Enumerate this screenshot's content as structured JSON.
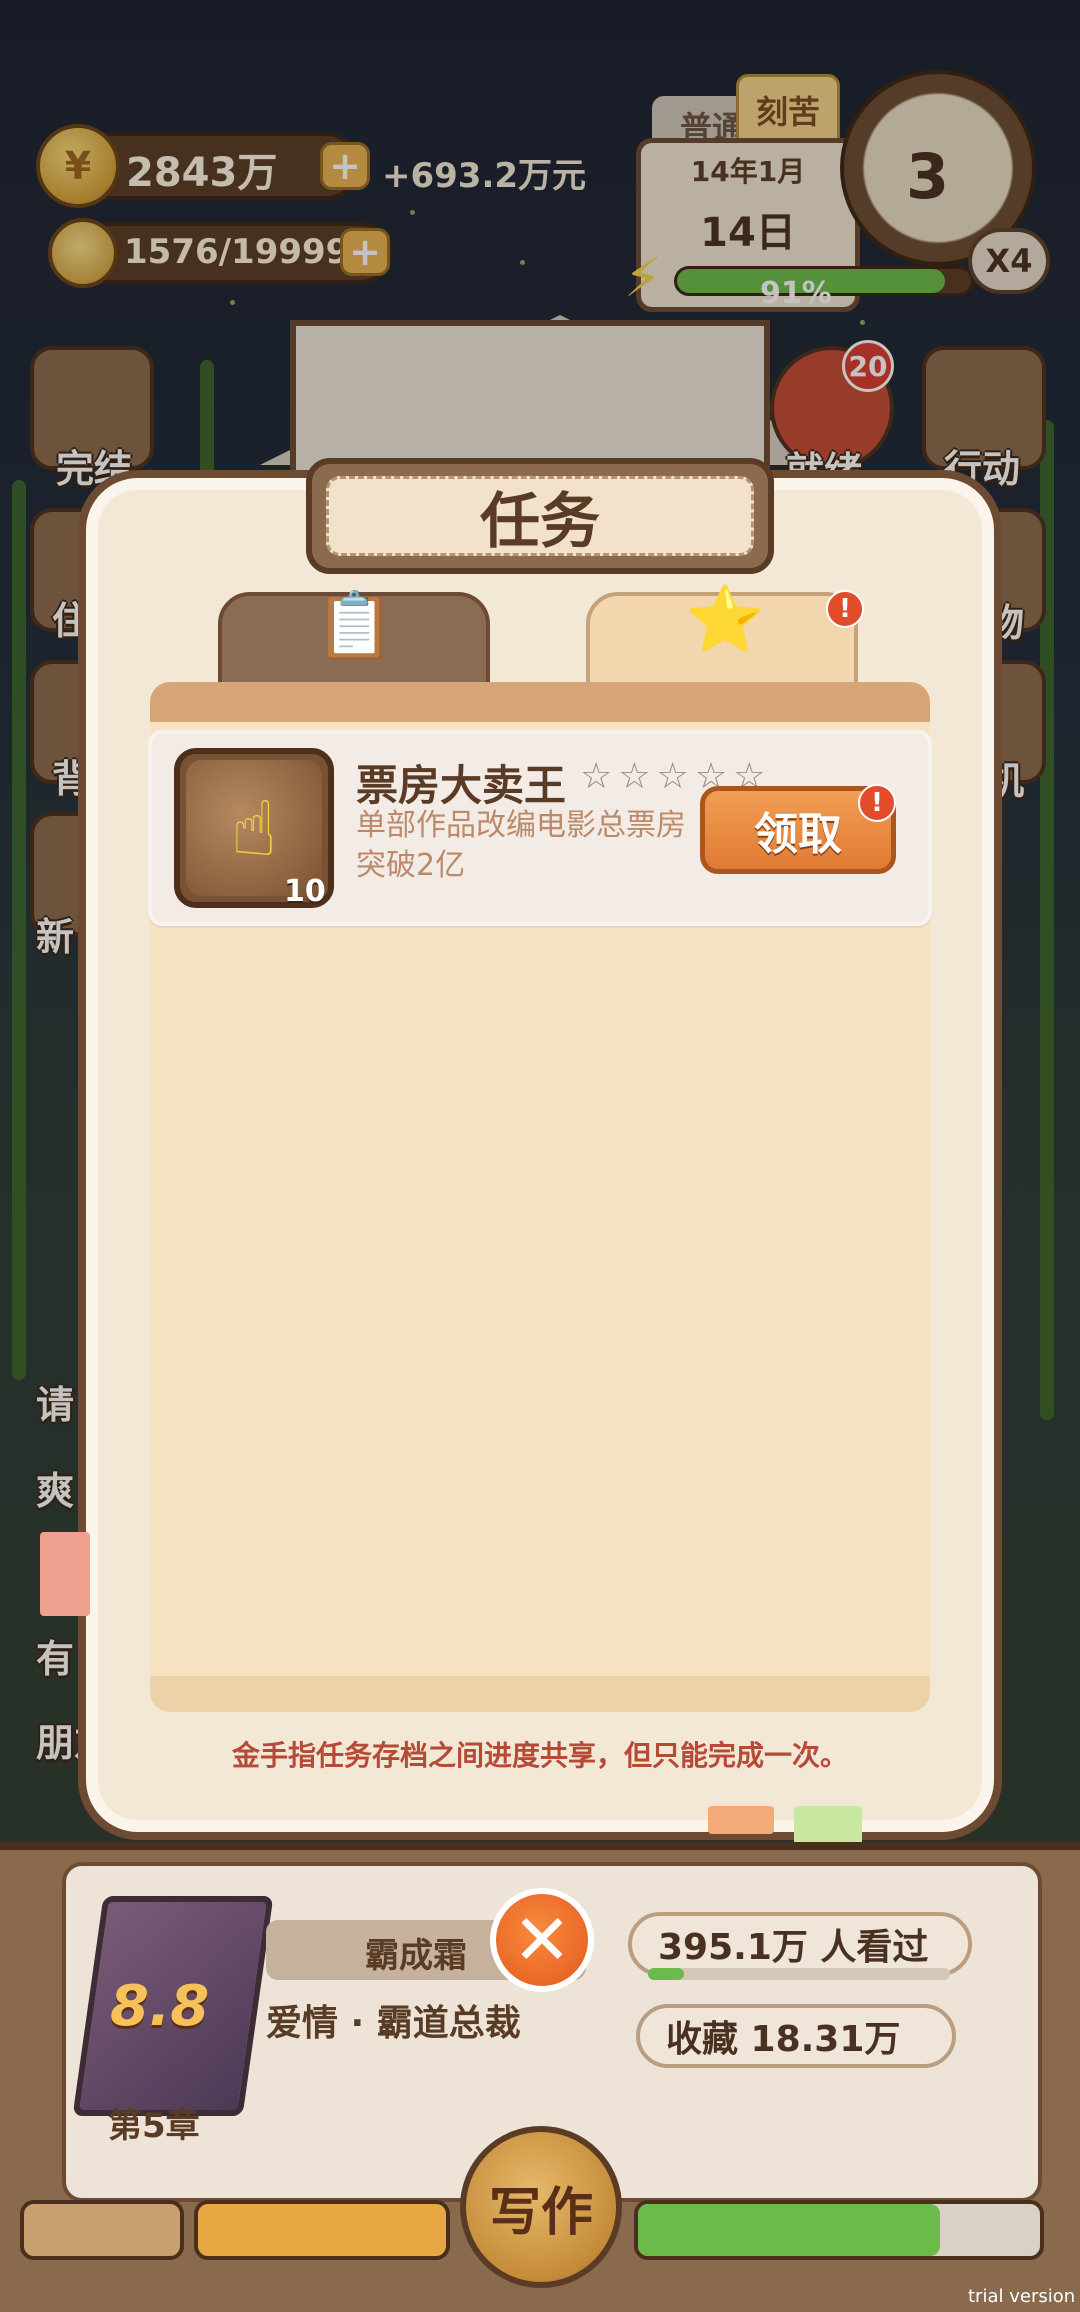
{
  "hud": {
    "money": "2843万",
    "money_rate": "+693.2万元",
    "energy": "1576/19999",
    "mode_normal": "普通",
    "mode_hard": "刻苦",
    "date_month": "14年1月",
    "date_day": "14日",
    "progress_text": "91%",
    "progress_value": 0.91,
    "clock_number": "3",
    "speed": "X4"
  },
  "side_menu": {
    "finish_label": "完结",
    "action_label": "行动",
    "notice_count": "20",
    "left_partial": [
      "住",
      "背",
      "新",
      "请",
      "爽",
      "有",
      "朋友"
    ],
    "right_partial": [
      "就绪",
      "物",
      "机"
    ]
  },
  "modal": {
    "title": "任务",
    "tab_left_icon": "clipboard-icon",
    "tab_right_icon": "star-badge-icon",
    "task": {
      "title": "票房大卖王",
      "stars": "☆☆☆☆☆",
      "desc": "单部作品改编电影总票房突破2亿",
      "count": "10",
      "claim_label": "领取"
    },
    "note": "金手指任务存档之间进度共享，但只能完成一次。"
  },
  "book": {
    "score": "8.8",
    "chapter": "第5章",
    "name": "霸成霜",
    "genre": "爱情 · 霸道总裁",
    "views": "395.1万 人看过",
    "views_progress": 0.12,
    "favorites": "收藏  18.31万",
    "write_label": "写作"
  },
  "watermark": "trial version",
  "colors": {
    "brown_dark": "#5a3b25",
    "cream": "#f7e2c1",
    "orange": "#e07a34",
    "green": "#6bbb4a",
    "alert_red": "#e24c2a"
  }
}
